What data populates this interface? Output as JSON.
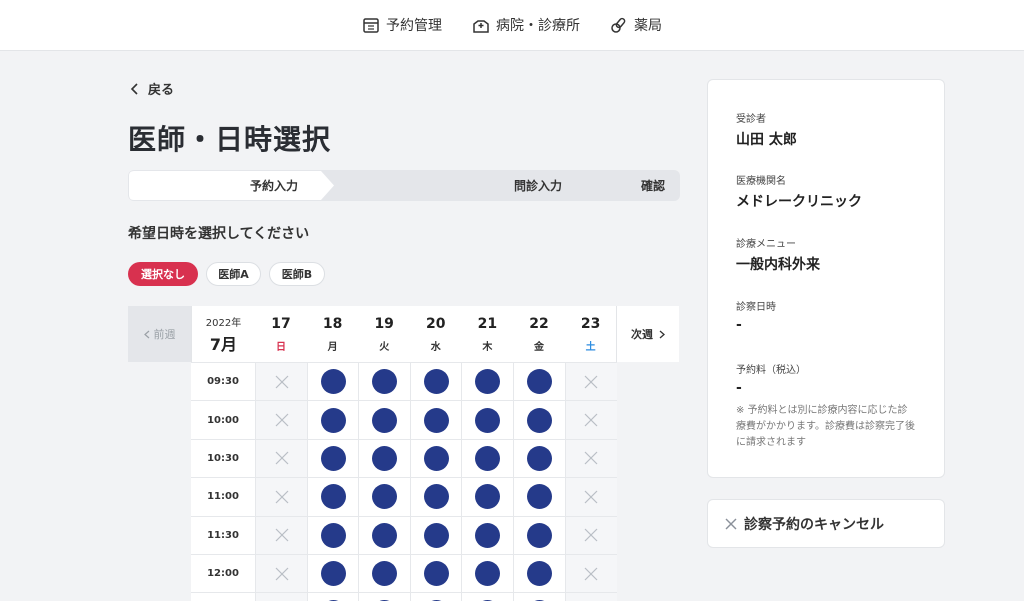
{
  "nav": {
    "items": [
      {
        "label": "予約管理",
        "icon": "calendar-icon"
      },
      {
        "label": "病院・診療所",
        "icon": "hospital-icon"
      },
      {
        "label": "薬局",
        "icon": "pill-icon"
      }
    ]
  },
  "back_label": "戻る",
  "page_title": "医師・日時選択",
  "steps": [
    "予約入力",
    "問診入力",
    "確認"
  ],
  "subtitle": "希望日時を選択してください",
  "filters": [
    "選択なし",
    "医師A",
    "医師B"
  ],
  "calendar": {
    "prev_label": "前週",
    "next_label": "次週",
    "year": "2022年",
    "month": "7月",
    "days": [
      {
        "date": "17",
        "weekday": "日"
      },
      {
        "date": "18",
        "weekday": "月"
      },
      {
        "date": "19",
        "weekday": "火"
      },
      {
        "date": "20",
        "weekday": "水"
      },
      {
        "date": "21",
        "weekday": "木"
      },
      {
        "date": "22",
        "weekday": "金"
      },
      {
        "date": "23",
        "weekday": "土"
      }
    ],
    "times": [
      "09:30",
      "10:00",
      "10:30",
      "11:00",
      "11:30",
      "12:00"
    ],
    "availability": [
      false,
      true,
      true,
      true,
      true,
      true,
      false
    ]
  },
  "panel": {
    "patient_label": "受診者",
    "patient_value": "山田 太郎",
    "clinic_label": "医療機関名",
    "clinic_value": "メドレークリニック",
    "menu_label": "診療メニュー",
    "menu_value": "一般内科外来",
    "date_label": "診察日時",
    "date_value": "-",
    "fee_label": "予約料（税込）",
    "fee_value": "-",
    "note": "※ 予約料とは別に診療内容に応じた診療費がかかります。診療費は診察完了後に請求されます"
  },
  "cancel_label": "診察予約のキャンセル",
  "colors": {
    "accent": "#d8314f",
    "available": "#253a8a",
    "saturday": "#2f8ee0"
  }
}
